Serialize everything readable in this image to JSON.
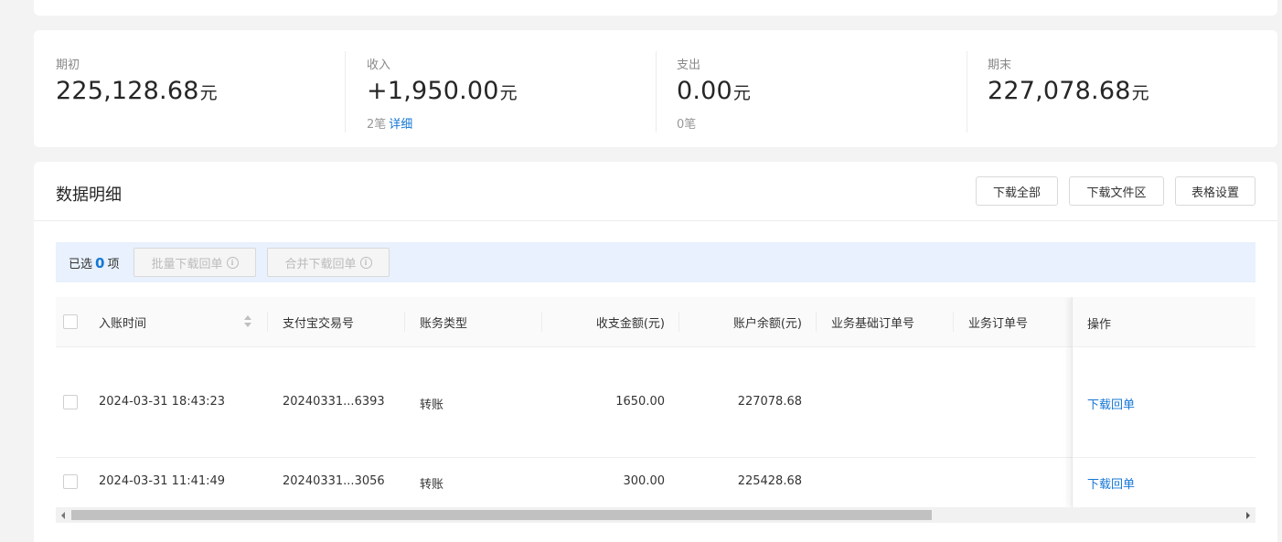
{
  "summary": {
    "opening": {
      "label": "期初",
      "amount": "225,128.68",
      "unit": "元"
    },
    "income": {
      "label": "收入",
      "amount": "+1,950.00",
      "unit": "元",
      "count": "2笔",
      "detail_link": "详细"
    },
    "expense": {
      "label": "支出",
      "amount": "0.00",
      "unit": "元",
      "count": "0笔"
    },
    "closing": {
      "label": "期末",
      "amount": "227,078.68",
      "unit": "元"
    }
  },
  "detail": {
    "title": "数据明细",
    "buttons": {
      "download_all": "下载全部",
      "download_area": "下载文件区",
      "table_settings": "表格设置"
    },
    "selection": {
      "prefix": "已选",
      "count": "0",
      "suffix": "项",
      "batch_download": "批量下载回单",
      "merge_download": "合并下载回单"
    },
    "columns": {
      "time": "入账时间",
      "trade_no": "支付宝交易号",
      "type": "账务类型",
      "amount": "收支金额(元)",
      "balance": "账户余额(元)",
      "base_order": "业务基础订单号",
      "order": "业务订单号",
      "action": "操作"
    },
    "rows": [
      {
        "time": "2024-03-31 18:43:23",
        "trade_no": "20240331...6393",
        "type": "转账",
        "amount": "1650.00",
        "balance": "227078.68",
        "base_order": "",
        "order": "",
        "action": "下载回单"
      },
      {
        "time": "2024-03-31 11:41:49",
        "trade_no": "20240331...3056",
        "type": "转账",
        "amount": "300.00",
        "balance": "225428.68",
        "base_order": "",
        "order": "",
        "action": "下载回单"
      }
    ]
  },
  "icons": {
    "info": "info-circle-icon",
    "sort": "sort-icon",
    "scroll_left": "arrow-left-icon",
    "scroll_right": "arrow-right-icon"
  },
  "colors": {
    "accent": "#1677d6",
    "selection_bar": "#e8f1fd",
    "background": "#f3f3f3"
  }
}
